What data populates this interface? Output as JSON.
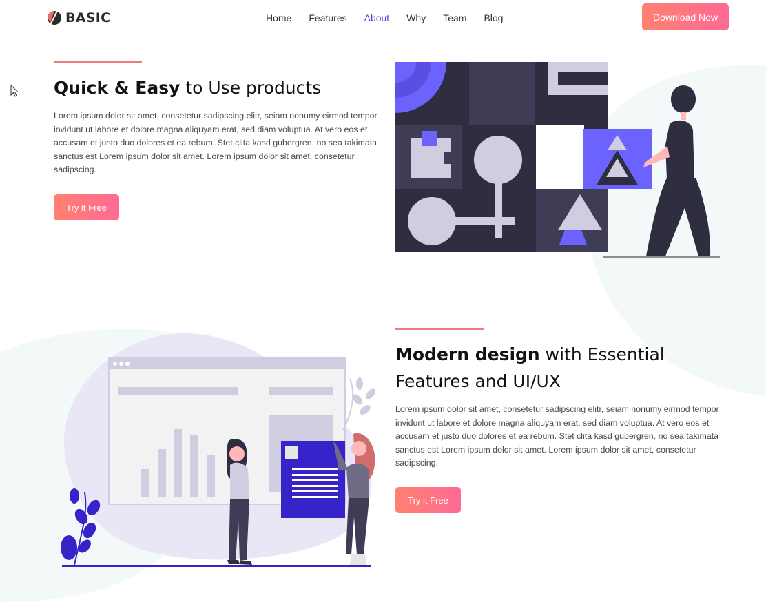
{
  "brand": {
    "name": "BASIC"
  },
  "nav": {
    "items": [
      {
        "label": "Home",
        "active": false
      },
      {
        "label": "Features",
        "active": false
      },
      {
        "label": "About",
        "active": true
      },
      {
        "label": "Why",
        "active": false
      },
      {
        "label": "Team",
        "active": false
      },
      {
        "label": "Blog",
        "active": false
      }
    ],
    "cta_label": "Download Now"
  },
  "section1": {
    "heading_bold": "Quick & Easy",
    "heading_light": " to Use products",
    "body": "Lorem ipsum dolor sit amet, consetetur sadipscing elitr, seiam nonumy eirmod tempor invidunt ut labore et dolore magna aliquyam erat, sed diam voluptua. At vero eos et accusam et justo duo dolores et ea rebum. Stet clita kasd gubergren, no sea takimata sanctus est Lorem ipsum dolor sit amet. Lorem ipsum dolor sit amet, consetetur sadipscing.",
    "button_label": "Try it Free"
  },
  "section2": {
    "heading_bold": "Modern design",
    "heading_light": " with Essential Features and UI/UX",
    "body": "Lorem ipsum dolor sit amet, consetetur sadipscing elitr, seiam nonumy eirmod tempor invidunt ut labore et dolore magna aliquyam erat, sed diam voluptua. At vero eos et accusam et justo duo dolores et ea rebum. Stet clita kasd gubergren, no sea takimata sanctus est Lorem ipsum dolor sit amet. Lorem ipsum dolor sit amet, consetetur sadipscing.",
    "button_label": "Try it Free"
  },
  "colors": {
    "accent_gradient_start": "#ff8170",
    "accent_gradient_end": "#ff6a95",
    "nav_active": "#4f3fd6",
    "accent_line": "#f17c7c",
    "illustration_dark": "#2f2e41",
    "illustration_purple": "#6c63ff",
    "illustration_indigo": "#3623c9"
  },
  "icons": {
    "logo": "leaf-logo-icon",
    "cursor": "mouse-pointer-icon"
  }
}
